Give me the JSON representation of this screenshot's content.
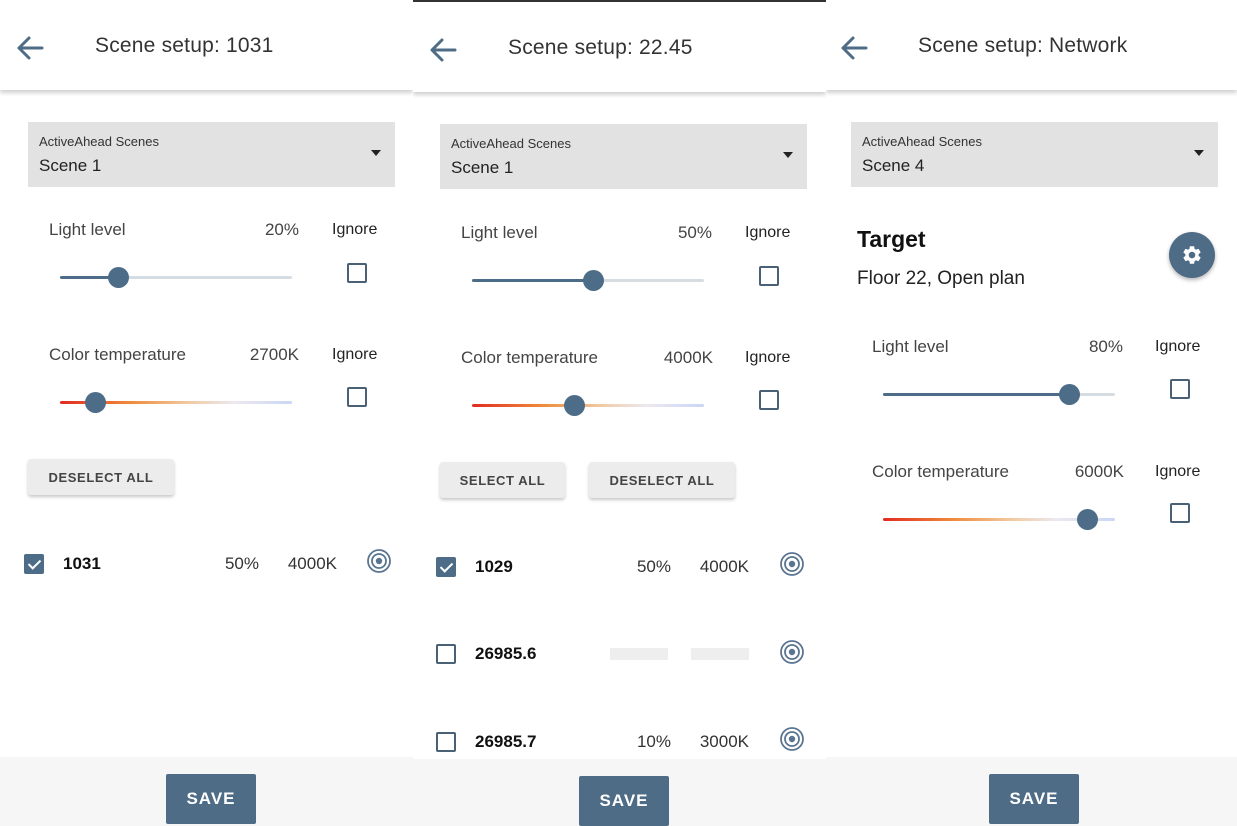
{
  "panels": [
    {
      "title": "Scene setup: 1031",
      "dropdown": {
        "label": "ActiveAhead Scenes",
        "value": "Scene 1"
      },
      "light": {
        "label": "Light level",
        "value": "20%",
        "ignore": "Ignore",
        "level": 0.25
      },
      "color": {
        "label": "Color temperature",
        "value": "2700K",
        "ignore": "Ignore",
        "level": 0.15
      },
      "deselect_all": "DESELECT ALL",
      "devices": [
        {
          "name": "1031",
          "level": "50%",
          "temp": "4000K",
          "checked": true
        }
      ],
      "save": "SAVE"
    },
    {
      "title": "Scene setup: 22.45",
      "dropdown": {
        "label": "ActiveAhead Scenes",
        "value": "Scene 1"
      },
      "light": {
        "label": "Light level",
        "value": "50%",
        "ignore": "Ignore",
        "level": 0.52
      },
      "color": {
        "label": "Color temperature",
        "value": "4000K",
        "ignore": "Ignore",
        "level": 0.44
      },
      "select_all": "SELECT ALL",
      "deselect_all": "DESELECT ALL",
      "devices": [
        {
          "name": "1029",
          "level": "50%",
          "temp": "4000K",
          "checked": true
        },
        {
          "name": "26985.6",
          "level": "",
          "temp": "",
          "checked": false
        },
        {
          "name": "26985.7",
          "level": "10%",
          "temp": "3000K",
          "checked": false
        }
      ],
      "save": "SAVE"
    },
    {
      "title": "Scene setup: Network",
      "dropdown": {
        "label": "ActiveAhead Scenes",
        "value": "Scene 4"
      },
      "target": {
        "title": "Target",
        "subtitle": "Floor 22, Open plan"
      },
      "light": {
        "label": "Light level",
        "value": "80%",
        "ignore": "Ignore",
        "level": 0.8
      },
      "color": {
        "label": "Color temperature",
        "value": "6000K",
        "ignore": "Ignore",
        "level": 0.88
      },
      "save": "SAVE"
    }
  ],
  "icons": {
    "back": "arrow-left-icon",
    "dropdown": "caret-down-icon",
    "identify": "target-icon",
    "settings": "gear-icon"
  },
  "colors": {
    "accent": "#4e6c86",
    "dropdown_bg": "#e2e2e2",
    "button_bg": "#ececec",
    "warm": "#e12b22",
    "cool": "#c9d7f5"
  }
}
